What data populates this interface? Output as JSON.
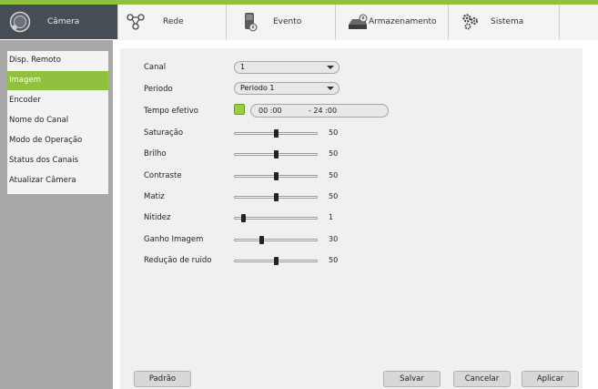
{
  "tabs": [
    {
      "label": "Câmera",
      "icon": "camera-icon",
      "active": true
    },
    {
      "label": "Rede",
      "icon": "network-icon",
      "active": false
    },
    {
      "label": "Evento",
      "icon": "event-icon",
      "active": false
    },
    {
      "label": "Armazenamento",
      "icon": "storage-icon",
      "active": false
    },
    {
      "label": "Sistema",
      "icon": "system-gears-icon",
      "active": false
    }
  ],
  "sidebar": {
    "items": [
      {
        "label": "Disp. Remoto",
        "active": false
      },
      {
        "label": "Imagem",
        "active": true
      },
      {
        "label": "Encoder",
        "active": false
      },
      {
        "label": "Nome do Canal",
        "active": false
      },
      {
        "label": "Modo de Operação",
        "active": false
      },
      {
        "label": "Status dos Canais",
        "active": false
      },
      {
        "label": "Atualizar Câmera",
        "active": false
      }
    ]
  },
  "form": {
    "canal": {
      "label": "Canal",
      "value": "1"
    },
    "periodo": {
      "label": "Periodo",
      "value": "Periodo 1"
    },
    "tempo": {
      "label": "Tempo efetivo",
      "start": "00 :00",
      "end": "- 24 :00"
    },
    "sliders": [
      {
        "label": "Saturação",
        "value": "50",
        "level": 0.5
      },
      {
        "label": "Brilho",
        "value": "50",
        "level": 0.5
      },
      {
        "label": "Contraste",
        "value": "50",
        "level": 0.5
      },
      {
        "label": "Matiz",
        "value": "50",
        "level": 0.5
      },
      {
        "label": "Nitidez",
        "value": "1",
        "level": 0.1
      },
      {
        "label": "Ganho Imagem",
        "value": "30",
        "level": 0.32
      },
      {
        "label": "Redução de ruido",
        "value": "50",
        "level": 0.5
      }
    ]
  },
  "buttons": {
    "default": "Padrão",
    "save": "Salvar",
    "cancel": "Cancelar",
    "apply": "Aplicar"
  },
  "colors": {
    "accent": "#8fc13e",
    "active_tab": "#474d54",
    "sidebar_bg": "#a8a8a8",
    "panel_bg": "#f0f0f0"
  }
}
